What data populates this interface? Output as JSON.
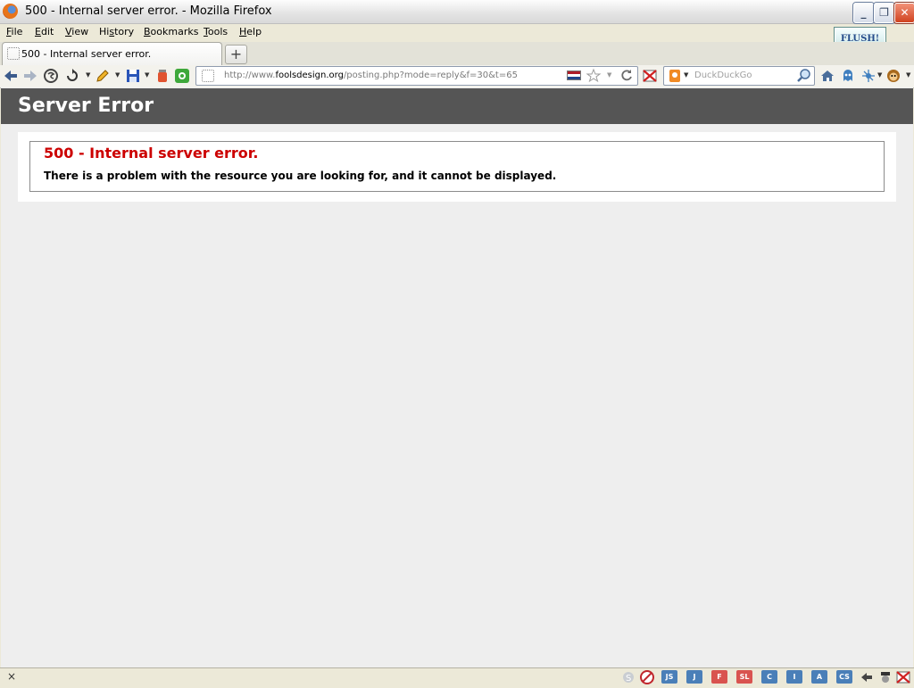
{
  "window": {
    "title": "500 - Internal server error. - Mozilla Firefox",
    "minimize": "_",
    "restore": "❐",
    "close": "✕"
  },
  "menubar": {
    "items": [
      {
        "first": "F",
        "rest": "ile"
      },
      {
        "first": "E",
        "rest": "dit"
      },
      {
        "first": "V",
        "rest": "iew"
      },
      {
        "first": "",
        "rest": "History",
        "mid_u": "s"
      },
      {
        "first": "B",
        "rest": "ookmarks"
      },
      {
        "first": "T",
        "rest": "ools"
      },
      {
        "first": "H",
        "rest": "elp"
      }
    ],
    "flush_label": "FLUSH!"
  },
  "tabs": {
    "active_title": "500 - Internal server error.",
    "new_tab": "+"
  },
  "navbar": {
    "url_prefix": "http://www.",
    "url_domain": "foolsdesign.org",
    "url_path": "/posting.php?mode=reply&f=30&t=65",
    "search_placeholder": "DuckDuckGo"
  },
  "page": {
    "header_title": "Server Error",
    "error_heading": "500 - Internal server error.",
    "error_message": "There is a problem with the resource you are looking for, and it cannot be displayed."
  },
  "statusbar": {
    "close": "×",
    "badges": [
      {
        "label": "JS",
        "color": "#4A7FB8"
      },
      {
        "label": "J",
        "color": "#4A7FB8"
      },
      {
        "label": "F",
        "color": "#D9534F"
      },
      {
        "label": "SL",
        "color": "#D9534F"
      },
      {
        "label": "C",
        "color": "#4A7FB8"
      },
      {
        "label": "I",
        "color": "#4A7FB8"
      },
      {
        "label": "A",
        "color": "#4A7FB8"
      },
      {
        "label": "CS",
        "color": "#4A7FB8"
      }
    ]
  },
  "colors": {
    "header_bg": "#555555",
    "error_red": "#CC0000",
    "page_bg": "#EEEEEE"
  }
}
